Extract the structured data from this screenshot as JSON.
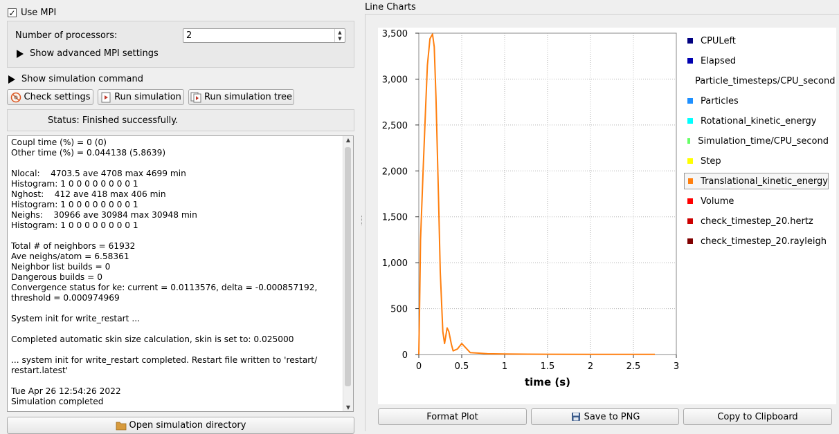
{
  "mpi": {
    "use_mpi_label": "Use MPI",
    "use_mpi_checked": true,
    "processors_label": "Number of processors:",
    "processors_value": "2",
    "advanced_label": "Show advanced MPI settings"
  },
  "simulation": {
    "show_command_label": "Show simulation command",
    "check_settings_label": "Check settings",
    "run_simulation_label": "Run simulation",
    "run_tree_label": "Run simulation tree",
    "status_text": "Status: Finished successfully.",
    "log_text": "Coupl time (%) = 0 (0)\nOther time (%) = 0.044138 (5.8639)\n\nNlocal:    4703.5 ave 4708 max 4699 min\nHistogram: 1 0 0 0 0 0 0 0 0 1\nNghost:    412 ave 418 max 406 min\nHistogram: 1 0 0 0 0 0 0 0 0 1\nNeighs:    30966 ave 30984 max 30948 min\nHistogram: 1 0 0 0 0 0 0 0 0 1\n\nTotal # of neighbors = 61932\nAve neighs/atom = 6.58361\nNeighbor list builds = 0\nDangerous builds = 0\nConvergence status for ke: current = 0.0113576, delta = -0.000857192,\nthreshold = 0.000974969\n\nSystem init for write_restart ...\n\nCompleted automatic skin size calculation, skin is set to: 0.025000\n\n... system init for write_restart completed. Restart file written to 'restart/\nrestart.latest'\n\nTue Apr 26 12:54:26 2022\nSimulation completed",
    "open_directory_label": "Open simulation directory"
  },
  "charts": {
    "panel_title": "Line Charts",
    "format_plot_label": "Format Plot",
    "save_png_label": "Save to PNG",
    "copy_clipboard_label": "Copy to Clipboard",
    "legend": [
      {
        "label": "CPULeft",
        "color": "#000080"
      },
      {
        "label": "Elapsed",
        "color": "#0000b0"
      },
      {
        "label": "Particle_timesteps/CPU_second",
        "color": "#0000ff"
      },
      {
        "label": "Particles",
        "color": "#1e90ff"
      },
      {
        "label": "Rotational_kinetic_energy",
        "color": "#00ffff"
      },
      {
        "label": "Simulation_time/CPU_second",
        "color": "#66ff66"
      },
      {
        "label": "Step",
        "color": "#ffff00"
      },
      {
        "label": "Translational_kinetic_energy",
        "color": "#ff7f0e",
        "selected": true
      },
      {
        "label": "Volume",
        "color": "#ff0000"
      },
      {
        "label": "check_timestep_20.hertz",
        "color": "#cc0000"
      },
      {
        "label": "check_timestep_20.rayleigh",
        "color": "#800000"
      }
    ]
  },
  "chart_data": {
    "type": "line",
    "title": "",
    "xlabel": "time (s)",
    "ylabel": "",
    "xlim": [
      0,
      3
    ],
    "ylim": [
      0,
      3500
    ],
    "x_ticks": [
      0,
      0.5,
      1,
      1.5,
      2,
      2.5,
      3
    ],
    "x_tick_labels": [
      "0",
      "0.5",
      "1",
      "1.5",
      "2",
      "2.5",
      "3"
    ],
    "y_ticks": [
      0,
      500,
      1000,
      1500,
      2000,
      2500,
      3000,
      3500
    ],
    "y_tick_labels": [
      "0",
      "500",
      "1,000",
      "1,500",
      "2,000",
      "2,500",
      "3,000",
      "3,500"
    ],
    "grid": true,
    "legend_position": "right",
    "series": [
      {
        "name": "Translational_kinetic_energy",
        "color": "#ff7f0e",
        "x": [
          0,
          0.01,
          0.02,
          0.05,
          0.08,
          0.1,
          0.13,
          0.16,
          0.18,
          0.2,
          0.23,
          0.25,
          0.28,
          0.3,
          0.33,
          0.35,
          0.38,
          0.4,
          0.45,
          0.5,
          0.55,
          0.6,
          0.7,
          0.8,
          1.0,
          1.5,
          2.0,
          2.5,
          2.75
        ],
        "y": [
          0,
          550,
          1250,
          2000,
          2700,
          3150,
          3440,
          3490,
          3350,
          2800,
          1700,
          900,
          250,
          120,
          290,
          250,
          110,
          40,
          60,
          120,
          70,
          20,
          15,
          8,
          5,
          3,
          2,
          2,
          2
        ]
      }
    ]
  }
}
